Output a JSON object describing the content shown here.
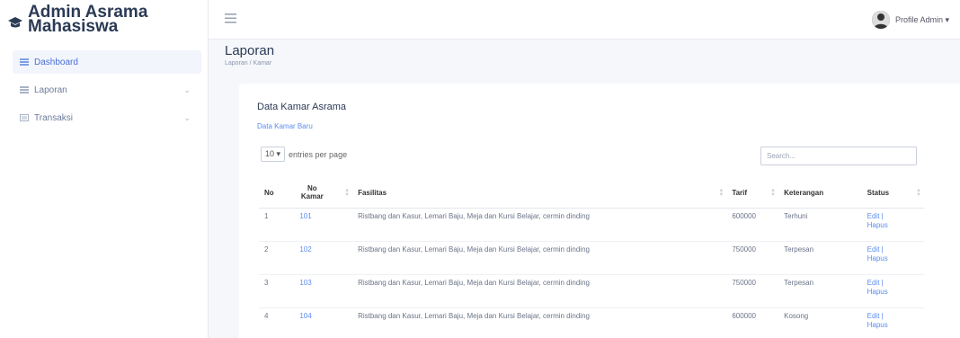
{
  "brand": {
    "line1": "Admin Asrama",
    "line2": "Mahasiswa"
  },
  "sidebar": {
    "items": [
      {
        "label": "Dashboard",
        "active": true,
        "icon": "dashboard-icon"
      },
      {
        "label": "Laporan",
        "active": false,
        "icon": "report-icon",
        "chevron": "⌄"
      },
      {
        "label": "Transaksi",
        "active": false,
        "icon": "transaction-icon",
        "chevron": "⌄"
      }
    ]
  },
  "topbar": {
    "menu_icon": "hamburger-icon",
    "profile_label": "Profile Admin ▾"
  },
  "page": {
    "title": "Laporan",
    "breadcrumb": "Laporan / Kamar"
  },
  "card": {
    "title": "Data Kamar Asrama",
    "new_link": "Data Kamar Baru",
    "entries_value": "10 ▾",
    "entries_label": "entries per page",
    "search_placeholder": "Search..."
  },
  "table": {
    "headers": {
      "no": "No",
      "kamar": "No Kamar",
      "fasilitas": "Fasilitas",
      "tarif": "Tarif",
      "keterangan": "Keterangan",
      "status": "Status"
    },
    "rows": [
      {
        "no": "1",
        "kamar": "101",
        "fasilitas": "Ristbang dan Kasur, Lemari Baju, Meja dan Kursi Belajar, cermin dinding",
        "tarif": "600000",
        "keterangan": "Terhuni",
        "edit": "Edit |",
        "hapus": "Hapus"
      },
      {
        "no": "2",
        "kamar": "102",
        "fasilitas": "Ristbang dan Kasur, Lemari Baju, Meja dan Kursi Belajar, cermin dinding",
        "tarif": "750000",
        "keterangan": "Terpesan",
        "edit": "Edit |",
        "hapus": "Hapus"
      },
      {
        "no": "3",
        "kamar": "103",
        "fasilitas": "Ristbang dan Kasur, Lemari Baju, Meja dan Kursi Belajar, cermin dinding",
        "tarif": "750000",
        "keterangan": "Terpesan",
        "edit": "Edit |",
        "hapus": "Hapus"
      },
      {
        "no": "4",
        "kamar": "104",
        "fasilitas": "Ristbang dan Kasur, Lemari Baju, Meja dan Kursi Belajar, cermin dinding",
        "tarif": "600000",
        "keterangan": "Kosong",
        "edit": "Edit |",
        "hapus": "Hapus"
      }
    ]
  }
}
